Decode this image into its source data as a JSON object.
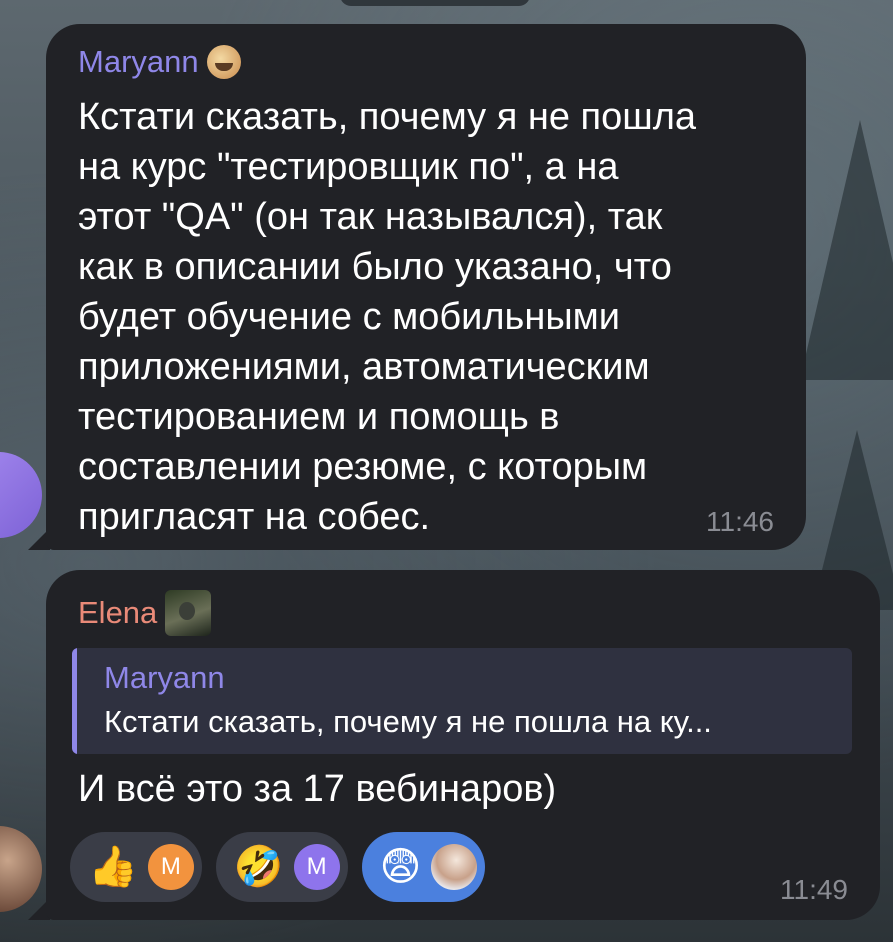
{
  "messages": [
    {
      "sender": "Maryann",
      "sender_emoji": "grinning-face-emoji",
      "text": "Кстати сказать, почему я не пошла\nна курс \"тестировщик по\", а на\nэтот \"QA\" (он так назывался), так\nкак в описании было указано, что\nбудет обучение с мобильными\nприложениями, автоматическим\nтестированием и помощь в\nсоставлении резюме, с которым\nпригласят на собес.",
      "time": "11:46"
    },
    {
      "sender": "Elena",
      "sender_badge": "photo-badge",
      "reply": {
        "name": "Maryann",
        "text": "Кстати сказать, почему я не пошла на ку..."
      },
      "text": "И всё это за 17 вебинаров)",
      "reactions": [
        {
          "emoji": "👍",
          "avatar_letter": "M",
          "avatar_color": "#f2933e",
          "selected": false
        },
        {
          "emoji": "🤣",
          "avatar_letter": "M",
          "avatar_color": "#8e74ec",
          "selected": false
        },
        {
          "emoji": "😨",
          "avatar_letter": "",
          "avatar_color": "photo",
          "selected": true
        }
      ],
      "time": "11:49"
    }
  ]
}
